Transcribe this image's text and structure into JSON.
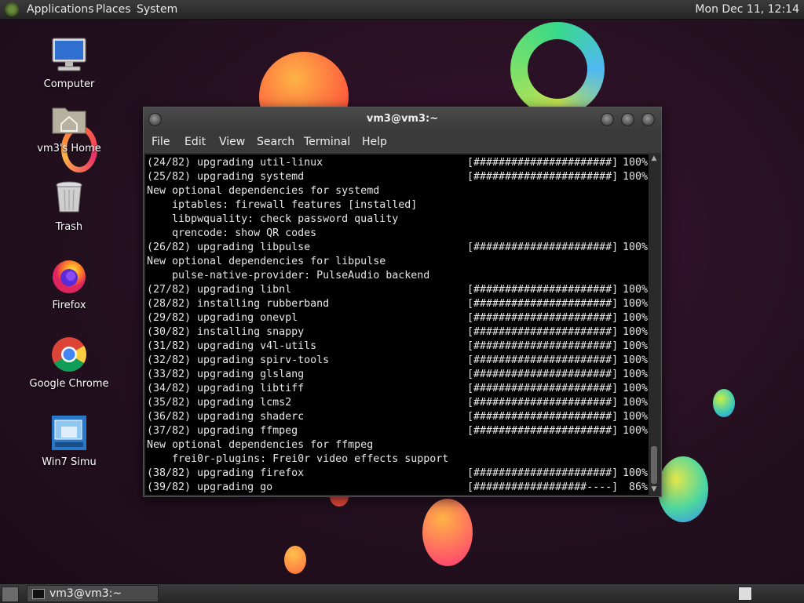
{
  "top_panel": {
    "menus": [
      "Applications",
      "Places",
      "System"
    ],
    "clock": "Mon Dec 11, 12:14"
  },
  "desktop_icons": [
    {
      "label": "Computer",
      "icon": "computer-icon"
    },
    {
      "label": "vm3's Home",
      "icon": "home-folder-icon"
    },
    {
      "label": "Trash",
      "icon": "trash-icon"
    },
    {
      "label": "Firefox",
      "icon": "firefox-icon"
    },
    {
      "label": "Google Chrome",
      "icon": "chrome-icon"
    },
    {
      "label": "Win7 Simu",
      "icon": "win7-simu-icon"
    }
  ],
  "terminal": {
    "title": "vm3@vm3:~",
    "menu": [
      "File",
      "Edit",
      "View",
      "Search",
      "Terminal",
      "Help"
    ],
    "lines": [
      {
        "text": "(24/82) upgrading util-linux",
        "bar": "[######################]",
        "pct": "100%"
      },
      {
        "text": "(25/82) upgrading systemd",
        "bar": "[######################]",
        "pct": "100%"
      },
      {
        "text": "New optional dependencies for systemd"
      },
      {
        "text": "    iptables: firewall features [installed]"
      },
      {
        "text": "    libpwquality: check password quality"
      },
      {
        "text": "    qrencode: show QR codes"
      },
      {
        "text": "(26/82) upgrading libpulse",
        "bar": "[######################]",
        "pct": "100%"
      },
      {
        "text": "New optional dependencies for libpulse"
      },
      {
        "text": "    pulse-native-provider: PulseAudio backend"
      },
      {
        "text": "(27/82) upgrading libnl",
        "bar": "[######################]",
        "pct": "100%"
      },
      {
        "text": "(28/82) installing rubberband",
        "bar": "[######################]",
        "pct": "100%"
      },
      {
        "text": "(29/82) upgrading onevpl",
        "bar": "[######################]",
        "pct": "100%"
      },
      {
        "text": "(30/82) installing snappy",
        "bar": "[######################]",
        "pct": "100%"
      },
      {
        "text": "(31/82) upgrading v4l-utils",
        "bar": "[######################]",
        "pct": "100%"
      },
      {
        "text": "(32/82) upgrading spirv-tools",
        "bar": "[######################]",
        "pct": "100%"
      },
      {
        "text": "(33/82) upgrading glslang",
        "bar": "[######################]",
        "pct": "100%"
      },
      {
        "text": "(34/82) upgrading libtiff",
        "bar": "[######################]",
        "pct": "100%"
      },
      {
        "text": "(35/82) upgrading lcms2",
        "bar": "[######################]",
        "pct": "100%"
      },
      {
        "text": "(36/82) upgrading shaderc",
        "bar": "[######################]",
        "pct": "100%"
      },
      {
        "text": "(37/82) upgrading ffmpeg",
        "bar": "[######################]",
        "pct": "100%"
      },
      {
        "text": "New optional dependencies for ffmpeg"
      },
      {
        "text": "    frei0r-plugins: Frei0r video effects support"
      },
      {
        "text": "(38/82) upgrading firefox",
        "bar": "[######################]",
        "pct": "100%"
      },
      {
        "text": "(39/82) upgrading go",
        "bar": "[##################----]",
        "pct": " 86%"
      }
    ]
  },
  "bottom_panel": {
    "task_label": "vm3@vm3:~"
  }
}
